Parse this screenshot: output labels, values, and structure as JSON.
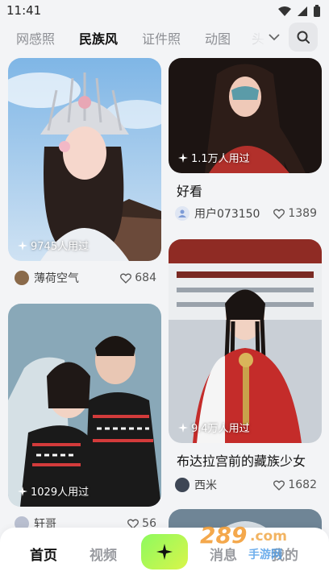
{
  "status_bar": {
    "time": "11:41"
  },
  "tabs": [
    {
      "label": "网感照",
      "active": false
    },
    {
      "label": "民族风",
      "active": true
    },
    {
      "label": "证件照",
      "active": false
    },
    {
      "label": "动图",
      "active": false
    },
    {
      "label": "头",
      "active": false
    }
  ],
  "cards": [
    {
      "used": "9745人用过",
      "user": "薄荷空气",
      "likes": "684"
    },
    {
      "used": "1.1万人用过",
      "title": "好看",
      "user": "用户073150",
      "likes": "1389"
    },
    {
      "used": "1029人用过",
      "user": "轩哥",
      "likes": "56"
    },
    {
      "used": "9.4万人用过",
      "title": "布达拉宫前的藏族少女",
      "user": "西米",
      "likes": "1682"
    }
  ],
  "bottom_nav": {
    "home": "首页",
    "video": "视频",
    "messages": "消息",
    "me": "我的"
  },
  "watermark": {
    "brand": "289",
    "suffix": ".com",
    "sub": "手游网"
  },
  "colors": {
    "accent": "#b6ef6b",
    "create_start": "#8dfa5f",
    "create_end": "#d9f54a"
  }
}
